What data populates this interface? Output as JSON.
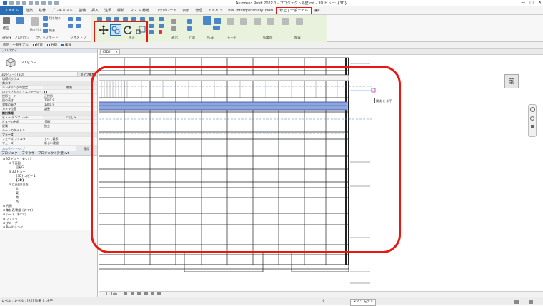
{
  "titlebar": {
    "title": "Autodesk Revit 2022.1 - プロジェクト外壁.rvt - 3D ビュー: {3D}",
    "min": "—",
    "max": "□",
    "close": "✕"
  },
  "tabs": [
    {
      "label": "ファイル"
    },
    {
      "label": "建築"
    },
    {
      "label": "鉄骨"
    },
    {
      "label": "プレキャスト"
    },
    {
      "label": "設備"
    },
    {
      "label": "挿入"
    },
    {
      "label": "注釈"
    },
    {
      "label": "解析"
    },
    {
      "label": "マス & 敷地"
    },
    {
      "label": "コラボレート"
    },
    {
      "label": "表示"
    },
    {
      "label": "管理"
    },
    {
      "label": "アドイン"
    },
    {
      "label": "BIM Interoperability Tools"
    },
    {
      "label": "修正 | 一般モデル"
    }
  ],
  "ribbon": {
    "panels": {
      "select": "選択 ▾",
      "properties": "プロパティ",
      "clipboard": "クリップボード",
      "geometry": "ジオメトリ",
      "modify": "修正",
      "view": "表示",
      "measure": "計測",
      "create": "作成",
      "mode": "モード",
      "workplane": "作業面",
      "placement": "配置"
    },
    "modify_label": "修正",
    "paste_label": "貼り付け",
    "cut_label": "切り取り",
    "join_label": "結合"
  },
  "optionsbar": {
    "context": "修正 | 一般モデル",
    "constrain": "拘束",
    "separate": "分割",
    "multiple": "複数"
  },
  "properties": {
    "header": "プロパティ",
    "type_name": "3D ビュー",
    "filter_value": "3D ビュー: {3D}",
    "edit_type": "タイプ編集",
    "rows": [
      {
        "k": "切断ボックス",
        "v": ""
      },
      {
        "k": "カメラ",
        "v": "",
        "grp": true
      },
      {
        "k": "レンダリングの設定",
        "v": "編集..."
      },
      {
        "k": "ロックされたオリエンテーション",
        "v": ""
      },
      {
        "k": "投影モード",
        "v": "正投影"
      },
      {
        "k": "目の高さ",
        "v": "1381.9"
      },
      {
        "k": "対象の高さ",
        "v": "1381.9"
      },
      {
        "k": "カメラ位置",
        "v": "調整"
      },
      {
        "k": "識別情報",
        "v": "",
        "grp": true
      },
      {
        "k": "ビュー テンプレート",
        "v": "<なし>"
      },
      {
        "k": "ビューの名前",
        "v": "{3D}"
      },
      {
        "k": "従属",
        "v": "独立"
      },
      {
        "k": "シートのタイトル",
        "v": ""
      },
      {
        "k": "フェーズ",
        "v": "",
        "grp": true
      },
      {
        "k": "フェーズ フィルタ",
        "v": "すべて表示"
      },
      {
        "k": "フェーズ",
        "v": "新しい建設"
      }
    ],
    "help": "プロパティ ヘルプ",
    "apply": "適用"
  },
  "browser": {
    "header": "プロジェクト ブラウザ - プロジェクト外壁.rvt",
    "items": [
      {
        "label": "⊟ [0] ビュー (すべて)",
        "indent": 1
      },
      {
        "label": "⊟ 平面図",
        "indent": 2
      },
      {
        "label": "回転GL",
        "indent": 3
      },
      {
        "label": "⊟ 3D ビュー",
        "indent": 2
      },
      {
        "label": "{3D} コピー 1",
        "indent": 3
      },
      {
        "label": "{3D}",
        "indent": 3
      },
      {
        "label": "⊟ 立面図 (立面)",
        "indent": 2
      },
      {
        "label": "北",
        "indent": 3
      },
      {
        "label": "東",
        "indent": 3
      },
      {
        "label": "南",
        "indent": 3
      },
      {
        "label": "西",
        "indent": 3
      },
      {
        "label": "⊞ 凡例",
        "indent": 1
      },
      {
        "label": "⊞ 集計表/数量 (すべて)",
        "indent": 1
      },
      {
        "label": "⊞ シート (すべて)",
        "indent": 1
      },
      {
        "label": "⊞ ファミリ",
        "indent": 1
      },
      {
        "label": "⊞ グループ",
        "indent": 1
      },
      {
        "label": "⊞ Revit リンク",
        "indent": 1
      }
    ]
  },
  "viewtab": {
    "label": "{3D}",
    "close": "×"
  },
  "viewcube": {
    "face": "前"
  },
  "tooltip": {
    "text": "隔成 と 水平"
  },
  "view_status": {
    "scale": "1 : 100"
  },
  "status": {
    "text": "レベル : レベル : [RE] 効果 と 水平",
    "model": "メイン モデル",
    "zero": ":0"
  }
}
